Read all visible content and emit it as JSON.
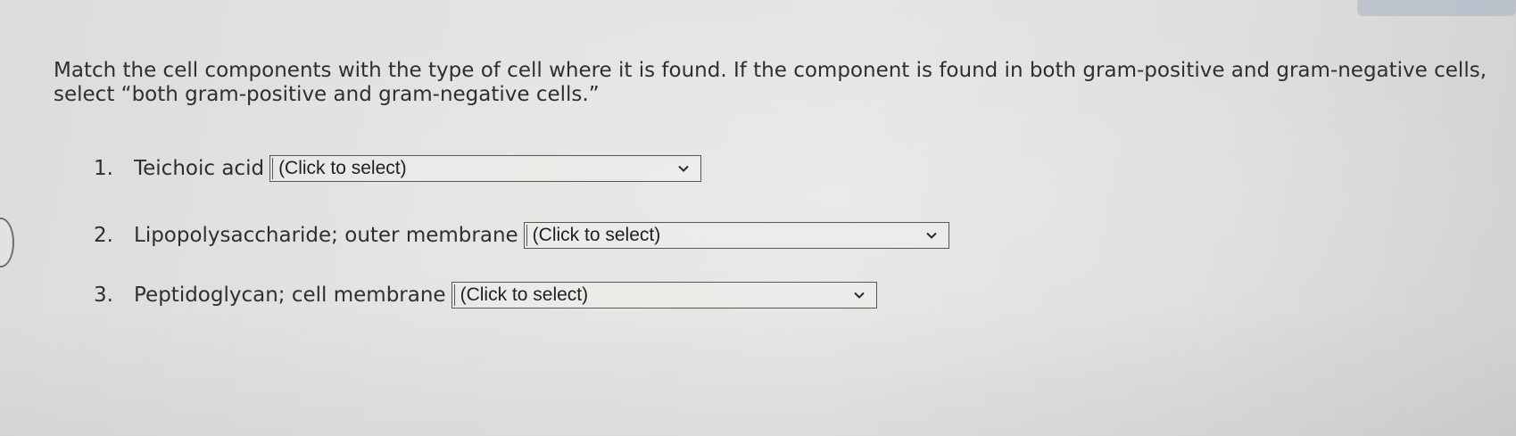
{
  "instructions": "Match the cell components with the type of cell where it is found. If the component is found in both gram-positive and gram-negative cells, select “both gram-positive and gram-negative cells.”",
  "items": [
    {
      "number": "1.",
      "label": "Teichoic acid",
      "select_value": "(Click to select)"
    },
    {
      "number": "2.",
      "label": "Lipopolysaccharide; outer membrane",
      "select_value": "(Click to select)"
    },
    {
      "number": "3.",
      "label": "Peptidoglycan; cell membrane",
      "select_value": "(Click to select)"
    }
  ],
  "icons": {
    "dropdown": "chevron-down-icon"
  }
}
